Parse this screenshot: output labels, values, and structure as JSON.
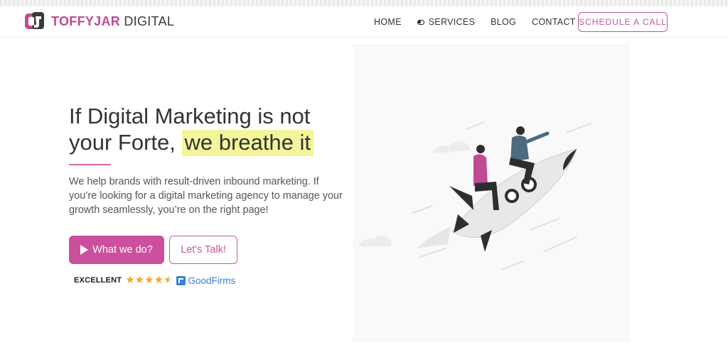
{
  "brand": {
    "name_part1": "TOFFYJAR",
    "name_part2": " DIGITAL"
  },
  "nav": {
    "items": [
      "HOME",
      "SERVICES",
      "BLOG",
      "CONTACT"
    ],
    "cta": "SCHEDULE A CALL"
  },
  "hero": {
    "headline_plain": "If Digital Marketing is not your Forte, ",
    "headline_highlight": "we breathe it",
    "description": "We help brands with result-driven inbound marketing. If you’re looking for a digital marketing agency to manage your growth seamlessly, you’re on the right page!",
    "primary_button": "What we do?",
    "secondary_button": "Let's Talk!"
  },
  "rating": {
    "label": "EXCELLENT",
    "stars": 4.5,
    "provider": "GoodFirms"
  },
  "colors": {
    "brand_pink": "#c04a94",
    "button_pink": "#cb4f9c",
    "highlight_yellow": "#f4f59a",
    "goodfirms_blue": "#3b7fe0"
  }
}
